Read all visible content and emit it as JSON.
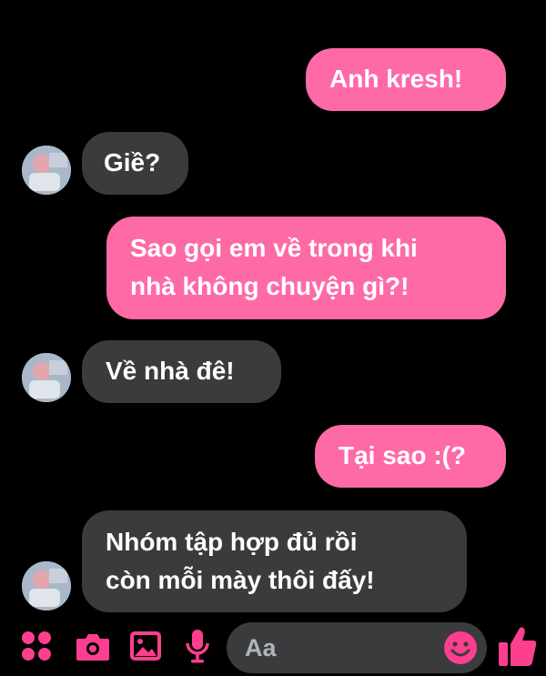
{
  "conversation": {
    "messages": [
      {
        "sender": "me",
        "lines": [
          "Anh kresh!"
        ]
      },
      {
        "sender": "them",
        "lines": [
          "Giề?"
        ]
      },
      {
        "sender": "me",
        "lines": [
          "Sao gọi em về trong khi",
          "nhà không chuyện gì?!"
        ]
      },
      {
        "sender": "them",
        "lines": [
          "Về nhà đê!"
        ]
      },
      {
        "sender": "me",
        "lines": [
          "Tại sao :(?"
        ]
      },
      {
        "sender": "them",
        "lines": [
          "Nhóm tập hợp đủ rồi",
          "còn mỗi mày thôi đấy!"
        ]
      }
    ]
  },
  "composer": {
    "placeholder": "Aa",
    "icons": [
      "menu-dots-icon",
      "camera-icon",
      "gallery-icon",
      "microphone-icon",
      "emoji-icon",
      "thumbs-up-icon"
    ]
  },
  "colors": {
    "background": "#000000",
    "sent_bubble": "#fe6aa6",
    "received_bubble": "#3a3b3c",
    "accent": "#fe3e8f",
    "text": "#ffffff"
  }
}
